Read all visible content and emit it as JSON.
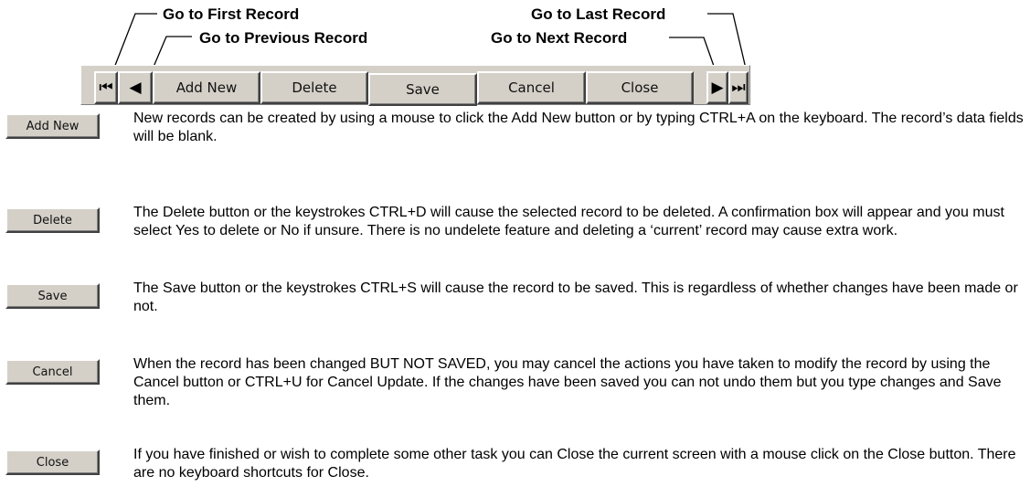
{
  "callouts": {
    "first": "Go to First Record",
    "previous": "Go to Previous Record",
    "last": "Go to Last Record",
    "next": "Go to Next Record"
  },
  "toolbar": {
    "first_glyph": "⏮",
    "prev_glyph": "◀",
    "add_new": "Add New",
    "delete": "Delete",
    "save": "Save",
    "cancel": "Cancel",
    "close": "Close",
    "next_glyph": "▶",
    "last_glyph": "⏭"
  },
  "rows": [
    {
      "button": "Add New",
      "text": "New records can be created by using a mouse to click the Add New button or by typing CTRL+A on the keyboard. The record’s data fields will be blank."
    },
    {
      "button": "Delete",
      "text": "The Delete button or the keystrokes CTRL+D will cause the selected record to be deleted. A confirmation box will appear and you must select Yes to delete or No if unsure.  There is no undelete feature and deleting a ‘current’ record may cause extra work."
    },
    {
      "button": "Save",
      "text": "The Save button or the keystrokes CTRL+S will cause the record to be saved. This is regardless of whether changes have been made or not."
    },
    {
      "button": "Cancel",
      "text": "When the record has been changed BUT NOT SAVED, you may cancel the actions you have taken to modify the record by using the Cancel button or CTRL+U for Cancel Update. If the changes have been saved you can not undo them but you type changes and Save them."
    },
    {
      "button": "Close",
      "text": "If you have finished or wish to complete some other task you can Close the current screen with a mouse click on the Close button. There are no keyboard shortcuts for Close."
    }
  ]
}
